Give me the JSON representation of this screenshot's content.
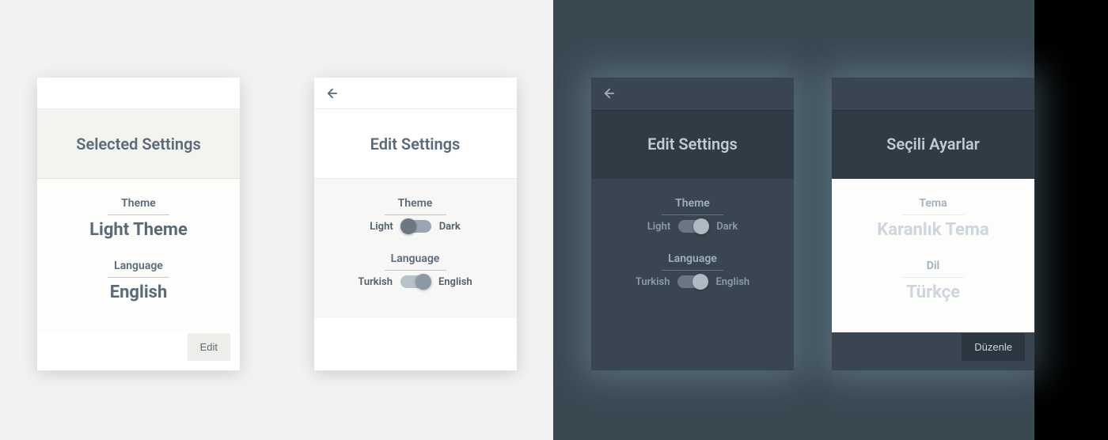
{
  "panels": [
    {
      "title": "Selected Settings",
      "theme_label": "Theme",
      "theme_value": "Light Theme",
      "language_label": "Language",
      "language_value": "English",
      "edit_label": "Edit"
    },
    {
      "title": "Edit Settings",
      "theme_label": "Theme",
      "theme_opt_left": "Light",
      "theme_opt_right": "Dark",
      "language_label": "Language",
      "language_opt_left": "Turkish",
      "language_opt_right": "English"
    },
    {
      "title": "Edit Settings",
      "theme_label": "Theme",
      "theme_opt_left": "Light",
      "theme_opt_right": "Dark",
      "language_label": "Language",
      "language_opt_left": "Turkish",
      "language_opt_right": "English"
    },
    {
      "title": "Seçili Ayarlar",
      "theme_label": "Tema",
      "theme_value": "Karanlık Tema",
      "language_label": "Dil",
      "language_value": "Türkçe",
      "edit_label": "Düzenle"
    }
  ],
  "colors": {
    "light_bg": "#f2f2f0",
    "dark_bg": "#3a4852",
    "light_text": "#5a6a78",
    "dark_text": "#c0cbd4"
  }
}
